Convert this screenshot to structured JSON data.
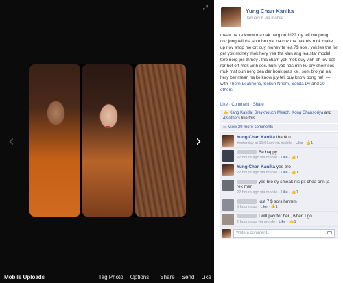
{
  "viewer": {
    "album_label": "Mobile Uploads",
    "actions": [
      "Tag Photo",
      "Options",
      "Share",
      "Send",
      "Like"
    ]
  },
  "post": {
    "user_name": "Yung Chan Kanika",
    "meta": "January 6 via mobile",
    "text": "mean na ke know ma nak nerg ort fri?? juy tell me pong . coz jong tell tha som bro yat na coz ma nak nis mok make up nov shop me ort ouy money te tea 7$ sos . yok les tha for get yok money mok hery yea tha klun ang lea star model terb nerg jos thmey . tha cham yok mok ouy vinh ah lov bat ror hot ort mok vinh sos. hum yab nas min ku ory cherr sos muk mat pun nerg dea der bouk pras ke . som bro yat na hery ber mean na ke know juy tell ouy know pong na!! — with ",
    "tagged_text": "Thorn Leakhena, Sokun Nhem, Sonita Dy",
    "tagged_joiner": " and ",
    "tagged_more": "29 others",
    "tagged_end": "."
  },
  "ucs": {
    "like": "Like",
    "comment": "Comment",
    "share": "Share"
  },
  "likes": {
    "names": "Kang Kakda, Sreykhouch Meach, Kong Chansoriya",
    "joiner": " and ",
    "more": "48 others",
    "end": " like this."
  },
  "view_more": "View 29 more comments",
  "comments": [
    {
      "name": "Yung Chan Kanika",
      "text": " thank u",
      "time": "Yesterday at 10:01am via mobile",
      "likes": "1"
    },
    {
      "name": "",
      "text": "Be happy",
      "time": "22 hours ago via mobile",
      "likes": "1"
    },
    {
      "name": "Yung Chan Kanika",
      "text": " yes bro",
      "time": "22 hours ago via mobile",
      "likes": "1"
    },
    {
      "name": "",
      "text": "yes bro ey smeak nis pit chea onn ja rek men",
      "time": "22 hours ago via mobile",
      "likes": "1"
    },
    {
      "name": "",
      "text": "just 7 $ sors hmmm",
      "time": "5 hours ago",
      "likes": "1"
    },
    {
      "name": "",
      "text": "I will pay for her , when I go",
      "time": "2 hours ago via mobile",
      "likes": "1"
    }
  ],
  "comment_like_label": "Like",
  "composer_placeholder": "Write a comment...",
  "icons": [
    "expand-icon",
    "chevron-left-icon",
    "chevron-right-icon",
    "thumbs-up-icon",
    "comment-icon",
    "camera-icon"
  ],
  "colors": {
    "viewer_bg": "#0b0b0b",
    "link": "#3b5998",
    "muted": "#9197a3",
    "panel_bg": "#edeff4"
  }
}
